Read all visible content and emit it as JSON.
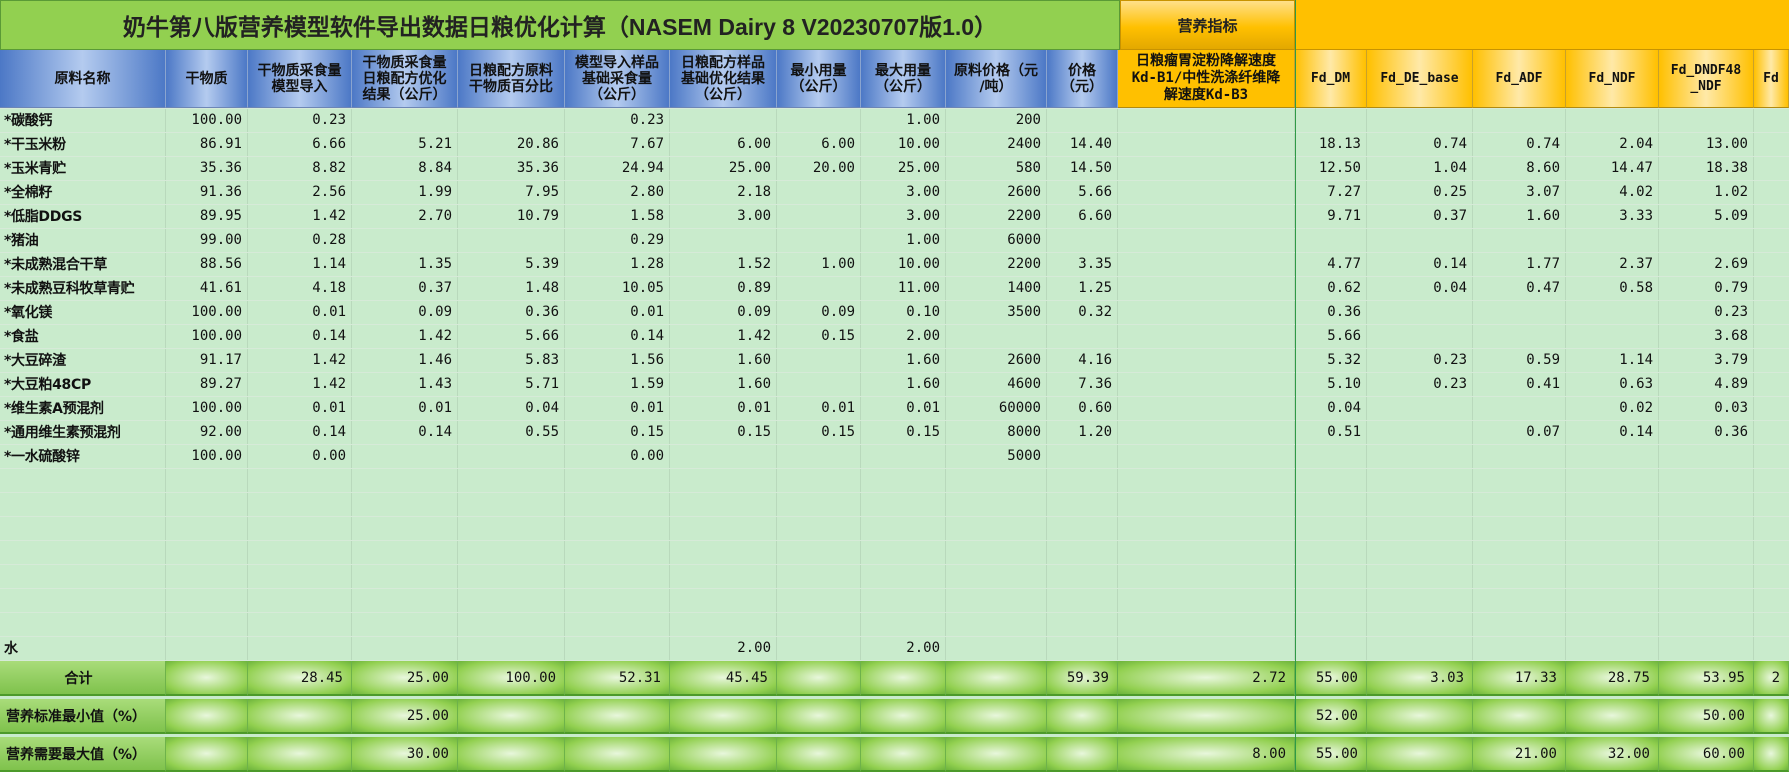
{
  "title": "奶牛第八版营养模型软件导出数据日粮优化计算（NASEM Dairy 8 V20230707版1.0）",
  "nutrition_title": "营养指标",
  "colors": {
    "title_bg": "#92d050",
    "header_blue": "#4c78c6",
    "header_orange": "#ffc000",
    "grid_bg": "#c9ebcc"
  },
  "headers": [
    "原料名称",
    "干物质",
    "干物质采食量\n模型导入",
    "干物质采食量\n日粮配方优化\n结果（公斤）",
    "日粮配方原料\n干物质百分比",
    "模型导入样品\n基础采食量\n（公斤）",
    "日粮配方样品\n基础优化结果\n（公斤）",
    "最小用量\n（公斤）",
    "最大用量\n（公斤）",
    "原料价格（元\n/吨）",
    "价格\n（元）",
    "日粮瘤胃淀粉降解速度\nKd-B1/中性洗涤纤维降\n解速度Kd-B3",
    "Fd_DM",
    "Fd_DE_base",
    "Fd_ADF",
    "Fd_NDF",
    "Fd_DNDF48\n_NDF",
    "Fd"
  ],
  "rows": [
    [
      "*碳酸钙",
      "100.00",
      "0.23",
      "",
      "",
      "0.23",
      "",
      "",
      "1.00",
      "200",
      "",
      "",
      "",
      "",
      "",
      "",
      "",
      ""
    ],
    [
      "*干玉米粉",
      "86.91",
      "6.66",
      "5.21",
      "20.86",
      "7.67",
      "6.00",
      "6.00",
      "10.00",
      "2400",
      "14.40",
      "",
      "18.13",
      "0.74",
      "0.74",
      "2.04",
      "13.00",
      ""
    ],
    [
      "*玉米青贮",
      "35.36",
      "8.82",
      "8.84",
      "35.36",
      "24.94",
      "25.00",
      "20.00",
      "25.00",
      "580",
      "14.50",
      "",
      "12.50",
      "1.04",
      "8.60",
      "14.47",
      "18.38",
      ""
    ],
    [
      "*全棉籽",
      "91.36",
      "2.56",
      "1.99",
      "7.95",
      "2.80",
      "2.18",
      "",
      "3.00",
      "2600",
      "5.66",
      "",
      "7.27",
      "0.25",
      "3.07",
      "4.02",
      "1.02",
      ""
    ],
    [
      "*低脂DDGS",
      "89.95",
      "1.42",
      "2.70",
      "10.79",
      "1.58",
      "3.00",
      "",
      "3.00",
      "2200",
      "6.60",
      "",
      "9.71",
      "0.37",
      "1.60",
      "3.33",
      "5.09",
      ""
    ],
    [
      "*猪油",
      "99.00",
      "0.28",
      "",
      "",
      "0.29",
      "",
      "",
      "1.00",
      "6000",
      "",
      "",
      "",
      "",
      "",
      "",
      "",
      ""
    ],
    [
      "*未成熟混合干草",
      "88.56",
      "1.14",
      "1.35",
      "5.39",
      "1.28",
      "1.52",
      "1.00",
      "10.00",
      "2200",
      "3.35",
      "",
      "4.77",
      "0.14",
      "1.77",
      "2.37",
      "2.69",
      ""
    ],
    [
      "*未成熟豆科牧草青贮",
      "41.61",
      "4.18",
      "0.37",
      "1.48",
      "10.05",
      "0.89",
      "",
      "11.00",
      "1400",
      "1.25",
      "",
      "0.62",
      "0.04",
      "0.47",
      "0.58",
      "0.79",
      ""
    ],
    [
      "*氧化镁",
      "100.00",
      "0.01",
      "0.09",
      "0.36",
      "0.01",
      "0.09",
      "0.09",
      "0.10",
      "3500",
      "0.32",
      "",
      "0.36",
      "",
      "",
      "",
      "0.23",
      ""
    ],
    [
      "*食盐",
      "100.00",
      "0.14",
      "1.42",
      "5.66",
      "0.14",
      "1.42",
      "0.15",
      "2.00",
      "",
      "",
      "",
      "5.66",
      "",
      "",
      "",
      "3.68",
      ""
    ],
    [
      "*大豆碎渣",
      "91.17",
      "1.42",
      "1.46",
      "5.83",
      "1.56",
      "1.60",
      "",
      "1.60",
      "2600",
      "4.16",
      "",
      "5.32",
      "0.23",
      "0.59",
      "1.14",
      "3.79",
      ""
    ],
    [
      "*大豆粕48CP",
      "89.27",
      "1.42",
      "1.43",
      "5.71",
      "1.59",
      "1.60",
      "",
      "1.60",
      "4600",
      "7.36",
      "",
      "5.10",
      "0.23",
      "0.41",
      "0.63",
      "4.89",
      ""
    ],
    [
      "*维生素A预混剂",
      "100.00",
      "0.01",
      "0.01",
      "0.04",
      "0.01",
      "0.01",
      "0.01",
      "0.01",
      "60000",
      "0.60",
      "",
      "0.04",
      "",
      "",
      "0.02",
      "0.03",
      ""
    ],
    [
      "*通用维生素预混剂",
      "92.00",
      "0.14",
      "0.14",
      "0.55",
      "0.15",
      "0.15",
      "0.15",
      "0.15",
      "8000",
      "1.20",
      "",
      "0.51",
      "",
      "0.07",
      "0.14",
      "0.36",
      ""
    ],
    [
      "*一水硫酸锌",
      "100.00",
      "0.00",
      "",
      "",
      "0.00",
      "",
      "",
      "",
      "5000",
      "",
      "",
      "",
      "",
      "",
      "",
      "",
      ""
    ]
  ],
  "water_row": [
    "水",
    "",
    "",
    "",
    "",
    "",
    "2.00",
    "",
    "2.00",
    "",
    "",
    "",
    "",
    "",
    "",
    "",
    "",
    ""
  ],
  "footer": [
    {
      "label": "合计",
      "values": [
        "",
        "28.45",
        "25.00",
        "100.00",
        "52.31",
        "45.45",
        "",
        "",
        "",
        "59.39",
        "2.72",
        "55.00",
        "3.03",
        "17.33",
        "28.75",
        "53.95",
        "2"
      ]
    },
    {
      "label": "营养标准最小值（%）",
      "values": [
        "",
        "",
        "25.00",
        "",
        "",
        "",
        "",
        "",
        "",
        "",
        "",
        "52.00",
        "",
        "",
        "",
        "50.00",
        ""
      ]
    },
    {
      "label": "营养需要最大值（%）",
      "values": [
        "",
        "",
        "30.00",
        "",
        "",
        "",
        "",
        "",
        "",
        "",
        "8.00",
        "55.00",
        "",
        "21.00",
        "32.00",
        "60.00",
        ""
      ]
    }
  ]
}
